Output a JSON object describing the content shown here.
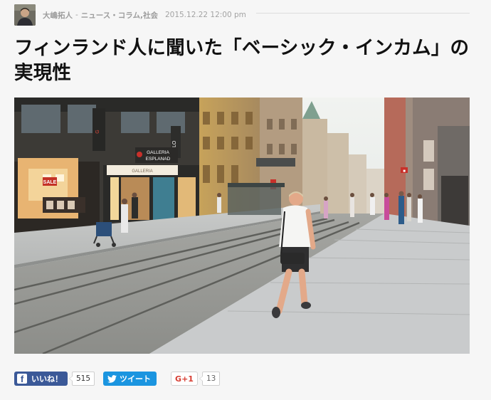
{
  "byline": {
    "author": "大嶋拓人",
    "separator": "-",
    "categories": "ニュース・コラム,社会",
    "date": "2015.12.22 12:00 pm"
  },
  "article": {
    "title": "フィンランド人に聞いた「ベーシック・インカム」の実現性"
  },
  "hero": {
    "storefront_sign_1": "GALLERIA",
    "storefront_sign_2": "ESPLANAD",
    "sign_sale": "SALE",
    "sign_glo": "GLO"
  },
  "share": {
    "facebook_label": "いいね！",
    "facebook_count": "515",
    "twitter_label": "ツイート",
    "googleplus_label": "G+1",
    "googleplus_count": "13"
  },
  "colors": {
    "facebook": "#3b5998",
    "twitter": "#1b95e0",
    "googleplus": "#d73d32",
    "background": "#f6f6f6"
  }
}
